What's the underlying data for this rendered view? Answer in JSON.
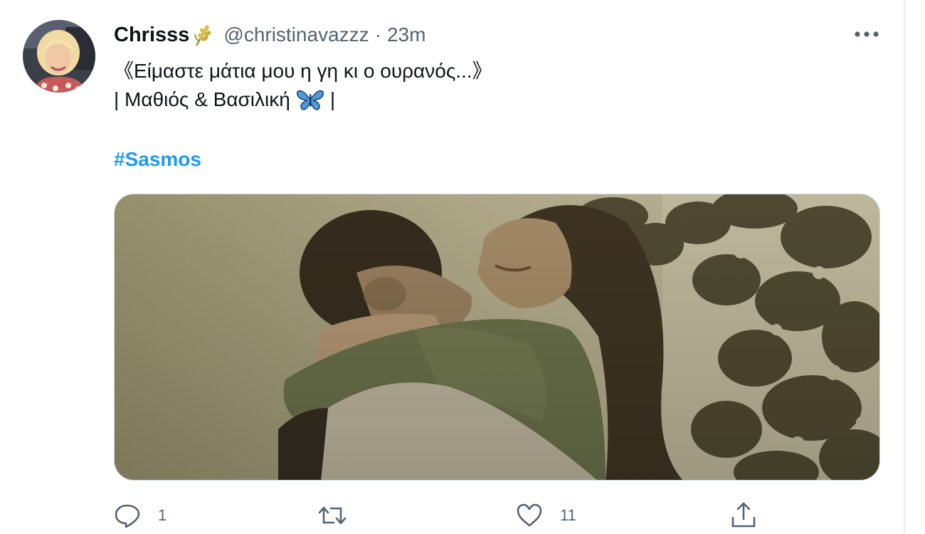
{
  "tweet": {
    "author": {
      "display_name": "Chrisss",
      "name_emoji": "wheat-emoji",
      "handle": "@christinavazzz",
      "separator": "·",
      "time": "23m"
    },
    "text": {
      "line1": "《Είμαστε μάτια μου η γη κι ο ουρανός...》",
      "line2_prefix": "| Μαθιός & Βασιλική",
      "line2_emoji": "butterfly-emoji",
      "line2_suffix": "|",
      "hashtag": "#Sasmos"
    },
    "media": {
      "kind": "video-still",
      "tone": "sepia"
    },
    "actions": {
      "reply": {
        "icon": "reply-icon",
        "count": "1"
      },
      "retweet": {
        "icon": "retweet-icon",
        "count": ""
      },
      "like": {
        "icon": "heart-icon",
        "count": "11"
      },
      "share": {
        "icon": "share-icon",
        "count": ""
      }
    },
    "more_icon": "more-options-icon"
  },
  "colors": {
    "text": "#0f1419",
    "secondary": "#536471",
    "link": "#1d9bf0",
    "border": "#cfd9de"
  }
}
